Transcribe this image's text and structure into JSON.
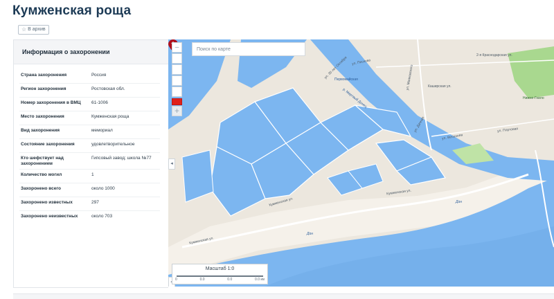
{
  "page": {
    "title": "Кумженская роща",
    "archive_label": "В архив"
  },
  "info": {
    "header": "Информация о захоронении",
    "rows": [
      {
        "label": "Страна захоронения",
        "value": "Россия"
      },
      {
        "label": "Регион захоронения",
        "value": "Ростовская обл."
      },
      {
        "label": "Номер захоронения в ВМЦ",
        "value": "61-1006"
      },
      {
        "label": "Место захоронения",
        "value": "Кумженская роща"
      },
      {
        "label": "Вид захоронения",
        "value": "мемориал"
      },
      {
        "label": "Состояние захоронения",
        "value": "удовлетворительное"
      },
      {
        "label": "Кто шефствует над захоронением",
        "value": "Гипсовый завод; школа №77"
      },
      {
        "label": "Количество могил",
        "value": "1"
      },
      {
        "label": "Захоронено всего",
        "value": "около 1000"
      },
      {
        "label": "Захоронено известных",
        "value": "297"
      },
      {
        "label": "Захоронено неизвестных",
        "value": "около 703"
      }
    ]
  },
  "map": {
    "search_placeholder": "Поиск по карте",
    "scale_label": "Масштаб 1:0",
    "scale_ticks": [
      "0",
      "0.0",
      "0.0",
      "0.0 км"
    ],
    "labels": {
      "pervomaiskaya": "Первомайская",
      "mertvy_donets": "р. Мертвый Донец",
      "kumzhenskaya1": "Кумженская ул.",
      "kumzhenskaya2": "Кумженская ул.",
      "kumzhenskaya3": "Кумженская ул.",
      "don1": "Дон",
      "don2": "Дон",
      "nizhne_gnilovskoy": "Нижне-Гнило",
      "portovaya": "ул. Портовая",
      "vesnyanaya": "ул. Весенняя",
      "krasnodarskaya": "2-я Краснодарская ул.",
      "kashirskaya": "Каширская ул.",
      "mayakovskogo": "ул. Маяковского",
      "peskova": "ул. Пескова",
      "oktyabrya": "ул. 30 лет Октября",
      "dachnaya": "ул. Дачная"
    },
    "colors": {
      "water": "#7cb6f0",
      "land": "#ece7de",
      "sand": "#f5f1ea",
      "park": "#a9d88f",
      "marker": "#b0101c"
    }
  }
}
